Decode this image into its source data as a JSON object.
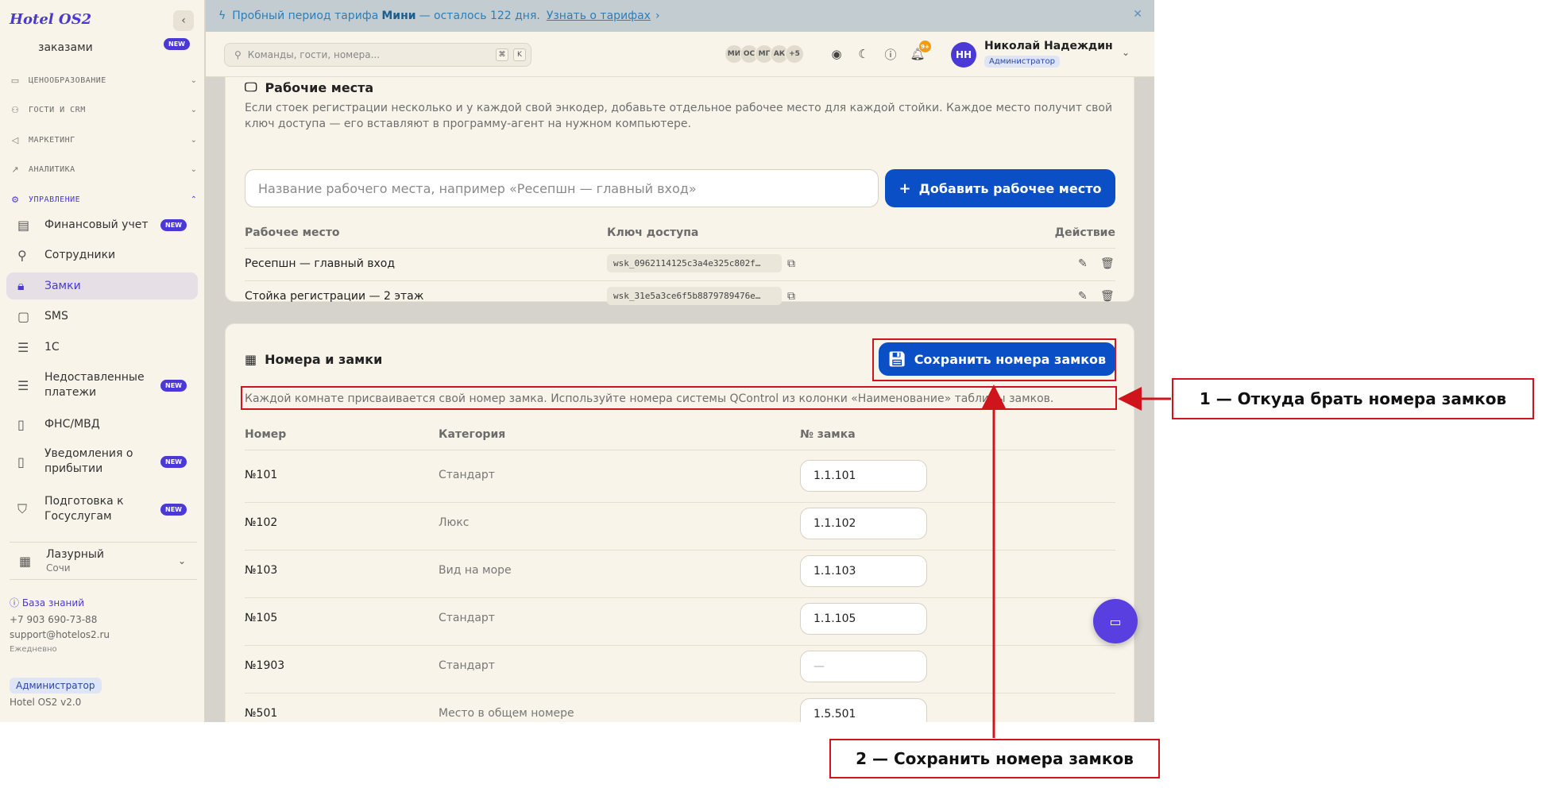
{
  "app": {
    "logo": "Hotel OS2"
  },
  "trial_banner": {
    "prefix": "Пробный период тарифа",
    "plan": "Мини",
    "suffix": "— осталось 122 дня.",
    "link": "Узнать о тарифах"
  },
  "search": {
    "placeholder": "Команды, гости, номера...",
    "kbd1": "⌘",
    "kbd2": "K"
  },
  "header": {
    "avatars": [
      "МИ",
      "ОС",
      "МГ",
      "АК",
      "+5"
    ],
    "notif_count": "9+",
    "user_initials": "НН",
    "user_name": "Николай Надеждин",
    "user_role": "Администратор"
  },
  "sidebar": {
    "partial_item": {
      "label": "заказами",
      "badge": "NEW"
    },
    "sections": {
      "pricing": "ЦЕНООБРАЗОВАНИЕ",
      "guests": "ГОСТИ И CRM",
      "marketing": "МАРКЕТИНГ",
      "analytics": "АНАЛИТИКА",
      "management": "УПРАВЛЕНИЕ"
    },
    "items": [
      {
        "label": "Финансовый учет",
        "badge": "NEW"
      },
      {
        "label": "Сотрудники",
        "badge": ""
      },
      {
        "label": "Замки",
        "badge": ""
      },
      {
        "label": "SMS",
        "badge": ""
      },
      {
        "label": "1С",
        "badge": ""
      },
      {
        "label": "Недоставленные платежи",
        "badge": "NEW"
      },
      {
        "label": "ФНС/МВД",
        "badge": ""
      },
      {
        "label": "Уведомления о прибытии",
        "badge": "NEW"
      },
      {
        "label": "Подготовка к Госуслугам",
        "badge": "NEW"
      }
    ],
    "hotel": {
      "name": "Лазурный",
      "city": "Сочи"
    },
    "kb_link": "База знаний",
    "phone": "+7 903 690-73-88",
    "email": "support@hotelos2.ru",
    "schedule": "Ежедневно",
    "role": "Администратор",
    "version": "Hotel OS2 v2.0"
  },
  "workplaces": {
    "title": "Рабочие места",
    "description": "Если стоек регистрации несколько и у каждой свой энкодер, добавьте отдельное рабочее место для каждой стойки. Каждое место получит свой ключ доступа — его вставляют в программу-агент на нужном компьютере.",
    "input_placeholder": "Название рабочего места, например «Ресепшн — главный вход»",
    "add_button": "Добавить рабочее место",
    "columns": {
      "place": "Рабочее место",
      "key": "Ключ доступа",
      "action": "Действие"
    },
    "rows": [
      {
        "name": "Ресепшн — главный вход",
        "key": "wsk_0962114125c3a4e325c802f…"
      },
      {
        "name": "Стойка регистрации — 2 этаж",
        "key": "wsk_31e5a3ce6f5b8879789476e…"
      }
    ]
  },
  "rooms": {
    "title": "Номера и замки",
    "save_button": "Сохранить номера замков",
    "description": "Каждой комнате присваивается свой номер замка. Используйте номера системы QControl из колонки «Наименование» таблицы замков.",
    "columns": {
      "room": "Номер",
      "category": "Категория",
      "lock": "№ замка"
    },
    "rows": [
      {
        "room": "№101",
        "category": "Стандарт",
        "lock": "1.1.101"
      },
      {
        "room": "№102",
        "category": "Люкс",
        "lock": "1.1.102"
      },
      {
        "room": "№103",
        "category": "Вид на море",
        "lock": "1.1.103"
      },
      {
        "room": "№105",
        "category": "Стандарт",
        "lock": "1.1.105"
      },
      {
        "room": "№1903",
        "category": "Стандарт",
        "lock": "—"
      },
      {
        "room": "№501",
        "category": "Место в общем номере",
        "lock": "1.5.501"
      }
    ]
  },
  "annotations": {
    "label1": "1 — Откуда брать номера замков",
    "label2": "2 — Сохранить номера замков",
    "color": "#d0141c"
  },
  "colors": {
    "accent": "#4b39d6",
    "primary_button": "#0b4fc7",
    "background": "#f8f4ea"
  }
}
